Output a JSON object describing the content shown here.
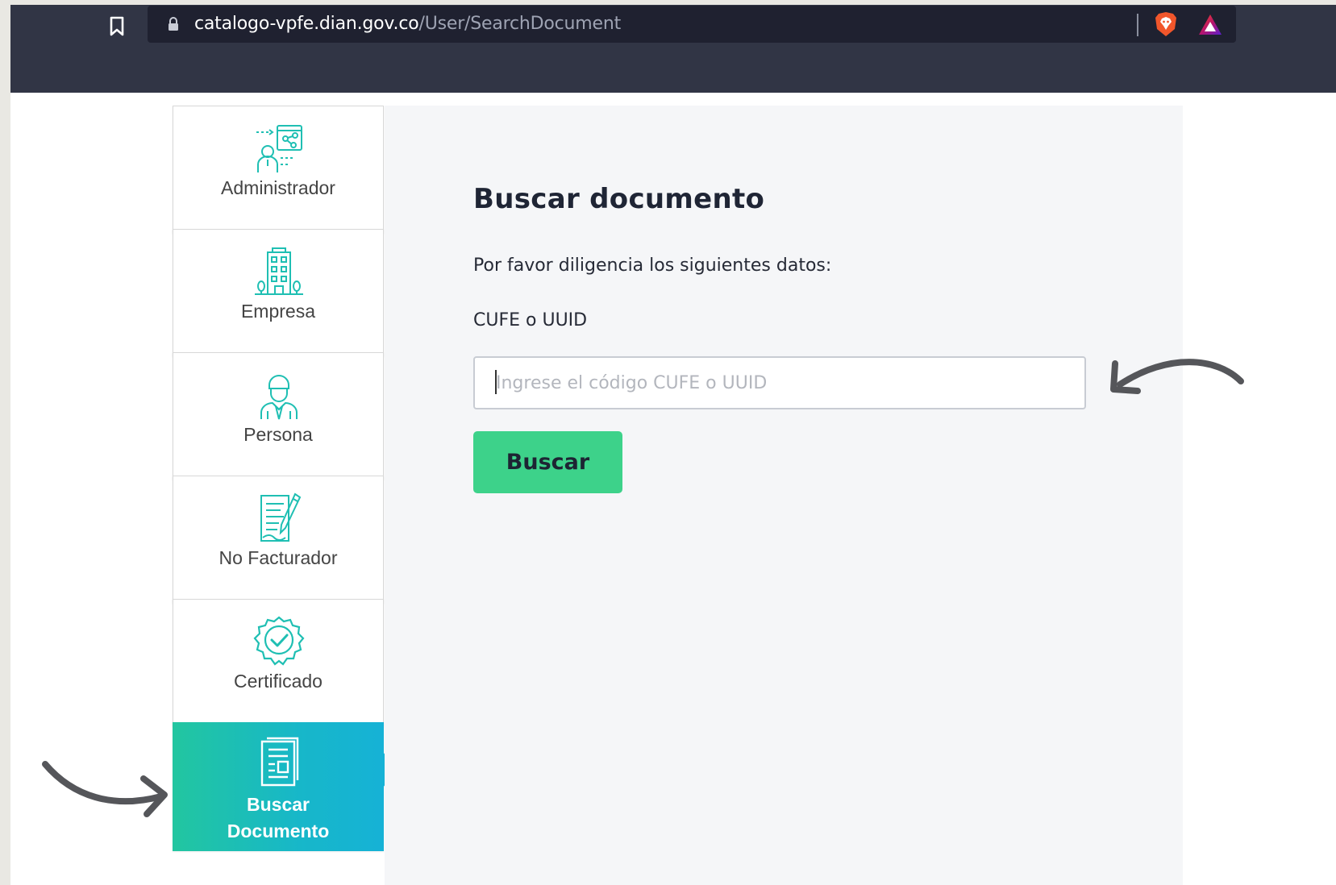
{
  "browser": {
    "url_domain": "catalogo-vpfe.dian.gov.co",
    "url_path": "/User/SearchDocument"
  },
  "sidebar": {
    "items": [
      {
        "label": "Administrador",
        "icon": "administrator-icon",
        "active": false
      },
      {
        "label": "Empresa",
        "icon": "building-icon",
        "active": false
      },
      {
        "label": "Persona",
        "icon": "person-icon",
        "active": false
      },
      {
        "label": "No Facturador",
        "icon": "document-pen-icon",
        "active": false
      },
      {
        "label": "Certificado",
        "icon": "certificate-badge-icon",
        "active": false
      },
      {
        "label_line1": "Buscar",
        "label_line2": "Documento",
        "icon": "search-document-icon",
        "active": true
      }
    ]
  },
  "main": {
    "title": "Buscar documento",
    "instructions": "Por favor diligencia los siguientes datos:",
    "field_label": "CUFE o UUID",
    "field_value": "",
    "field_placeholder": "Ingrese el código CUFE o UUID",
    "submit_label": "Buscar"
  },
  "colors": {
    "accent_teal": "#1fbfb3",
    "button_green": "#3dd28a",
    "browser_bg": "#313545",
    "annotation_arrow": "#55565a"
  }
}
